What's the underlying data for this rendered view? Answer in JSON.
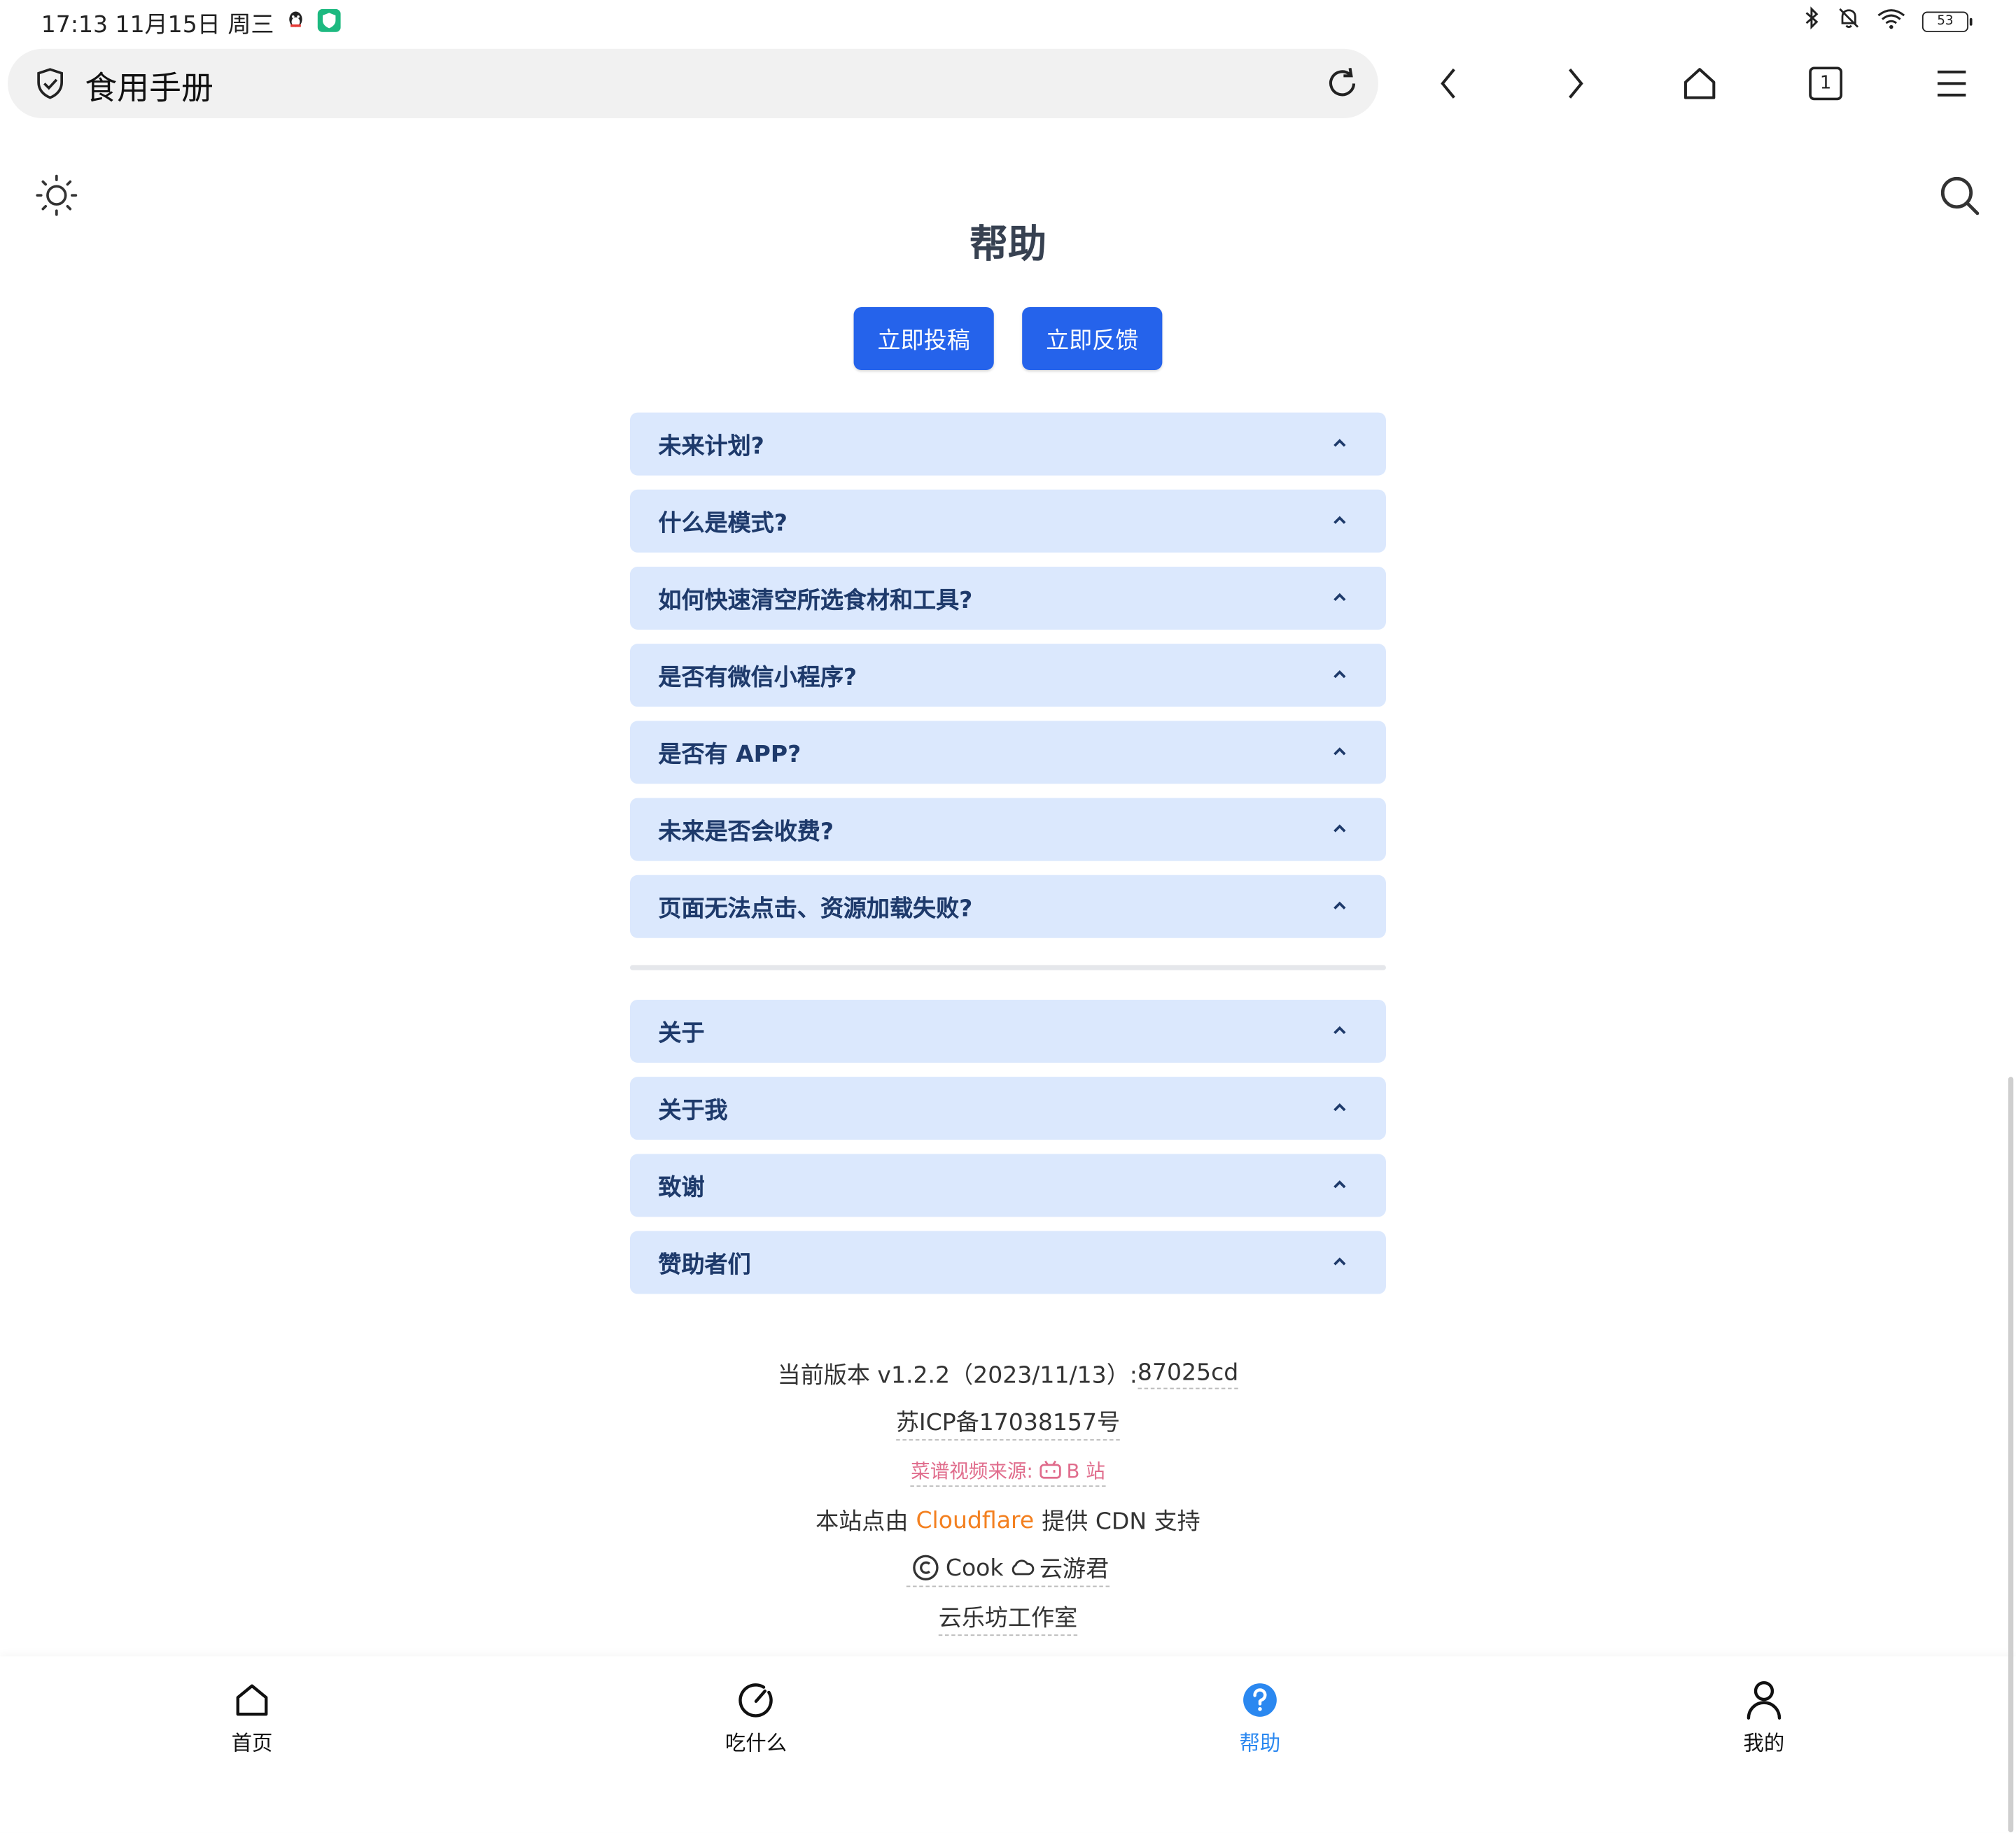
{
  "status_bar": {
    "time_date": "17:13 11月15日 周三",
    "battery": "53"
  },
  "browser": {
    "address_title": "食用手册",
    "tab_count": "1"
  },
  "page": {
    "title": "帮助",
    "buttons": {
      "submit": "立即投稿",
      "feedback": "立即反馈"
    }
  },
  "faq": [
    {
      "label": "未来计划?"
    },
    {
      "label": "什么是模式?"
    },
    {
      "label": "如何快速清空所选食材和工具?"
    },
    {
      "label": "是否有微信小程序?"
    },
    {
      "label": "是否有 APP?"
    },
    {
      "label": "未来是否会收费?"
    },
    {
      "label": "页面无法点击、资源加载失败?"
    }
  ],
  "about": [
    {
      "label": "关于"
    },
    {
      "label": "关于我"
    },
    {
      "label": "致谢"
    },
    {
      "label": "赞助者们"
    }
  ],
  "footer": {
    "version_prefix": "当前版本 v1.2.2（2023/11/13）: ",
    "version_hash": "87025cd",
    "icp": "苏ICP备17038157号",
    "video_source": "菜谱视频来源:",
    "bilibili": "B 站",
    "cdn_prefix": "本站点由",
    "cdn_name": "Cloudflare",
    "cdn_suffix": "提供 CDN 支持",
    "copyright_name": "Cook",
    "author": "云游君",
    "studio": "云乐坊工作室"
  },
  "tabbar": {
    "home": "首页",
    "eat": "吃什么",
    "help": "帮助",
    "mine": "我的"
  },
  "colors": {
    "primary": "#2563eb",
    "collapse_bg": "#dbe8fd",
    "active_tab": "#2b88f0",
    "cloudflare": "#f38020",
    "bilibili": "#e06c8c"
  }
}
